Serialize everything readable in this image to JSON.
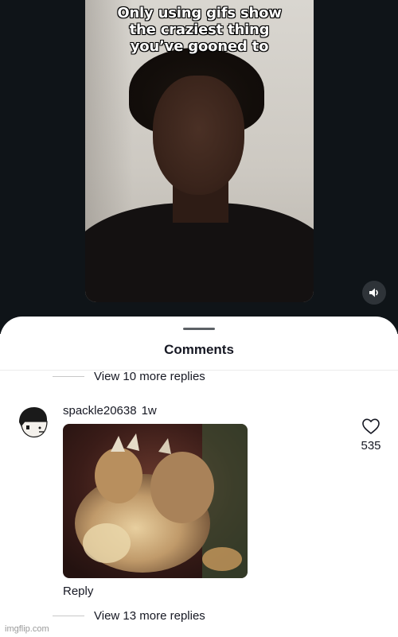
{
  "video": {
    "caption_lines": [
      "Only using gifs show",
      "the craziest thing",
      "you’ve gooned to"
    ],
    "volume_icon": "speaker-volume-icon"
  },
  "comments_sheet": {
    "title": "Comments",
    "view_more_top": "View 10 more replies",
    "comment": {
      "username": "spackle20638",
      "time": "1w",
      "reply_label": "Reply",
      "like_count": "535",
      "like_icon": "heart-outline-icon",
      "avatar_icon": "cartoon-avatar-icon",
      "attachment": "gif-image"
    },
    "view_more_bottom": "View 13 more replies"
  },
  "watermark": "imgflip.com",
  "colors": {
    "background_dark": "#0f1418",
    "sheet": "#ffffff",
    "text": "#161823",
    "muted": "#9a9a9a"
  }
}
